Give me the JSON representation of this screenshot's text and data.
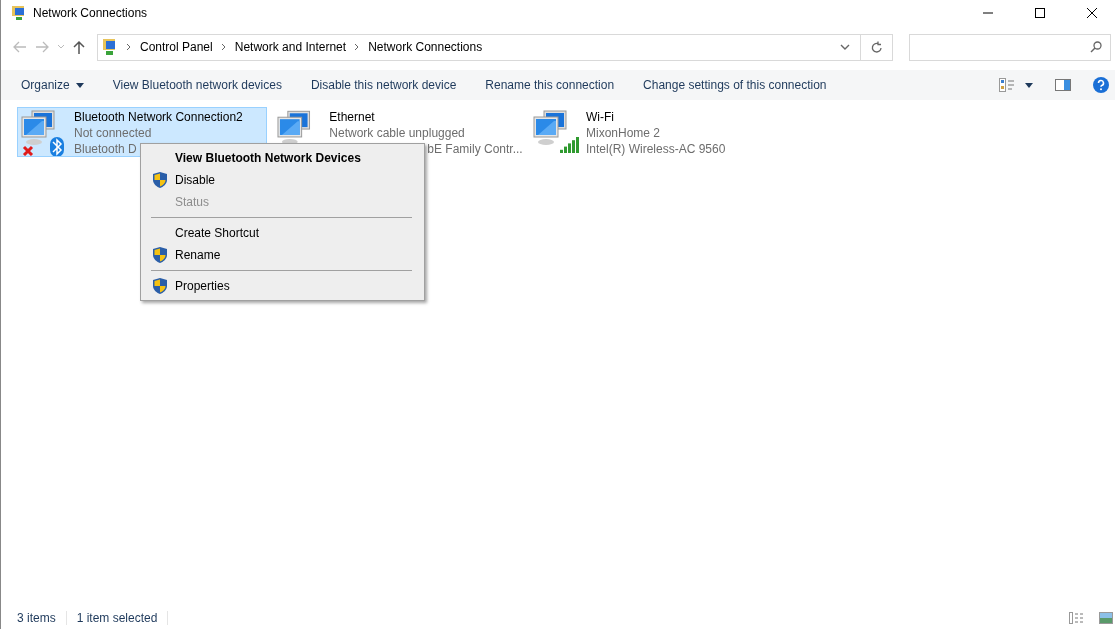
{
  "window": {
    "title": "Network Connections"
  },
  "address": {
    "crumbs": [
      "Control Panel",
      "Network and Internet",
      "Network Connections"
    ]
  },
  "toolbar": {
    "organize": "Organize",
    "commands": [
      "View Bluetooth network devices",
      "Disable this network device",
      "Rename this connection",
      "Change settings of this connection"
    ]
  },
  "items": [
    {
      "kind": "bluetooth",
      "name": "Bluetooth Network Connection2",
      "status": "Not connected",
      "device": "Bluetooth D",
      "device_partly_covered": false,
      "selected": true
    },
    {
      "kind": "ethernet",
      "name": "Ethernet",
      "status": "Network cable unplugged",
      "device": "bE Family Contr...",
      "device_partly_covered": true,
      "selected": false
    },
    {
      "kind": "wifi",
      "name": "Wi-Fi",
      "status": "MixonHome 2",
      "device": "Intel(R) Wireless-AC 9560",
      "device_partly_covered": false,
      "selected": false
    }
  ],
  "context_menu": {
    "items": [
      {
        "kind": "item",
        "label": "View Bluetooth Network Devices",
        "default": true,
        "shield": false,
        "disabled": false
      },
      {
        "kind": "item",
        "label": "Disable",
        "default": false,
        "shield": true,
        "disabled": false
      },
      {
        "kind": "item",
        "label": "Status",
        "default": false,
        "shield": false,
        "disabled": true
      },
      {
        "kind": "separator"
      },
      {
        "kind": "item",
        "label": "Create Shortcut",
        "default": false,
        "shield": false,
        "disabled": false
      },
      {
        "kind": "item",
        "label": "Rename",
        "default": false,
        "shield": true,
        "disabled": false
      },
      {
        "kind": "separator"
      },
      {
        "kind": "item",
        "label": "Properties",
        "default": false,
        "shield": true,
        "disabled": false
      }
    ]
  },
  "status_bar": {
    "count": "3 items",
    "selection": "1 item selected"
  }
}
